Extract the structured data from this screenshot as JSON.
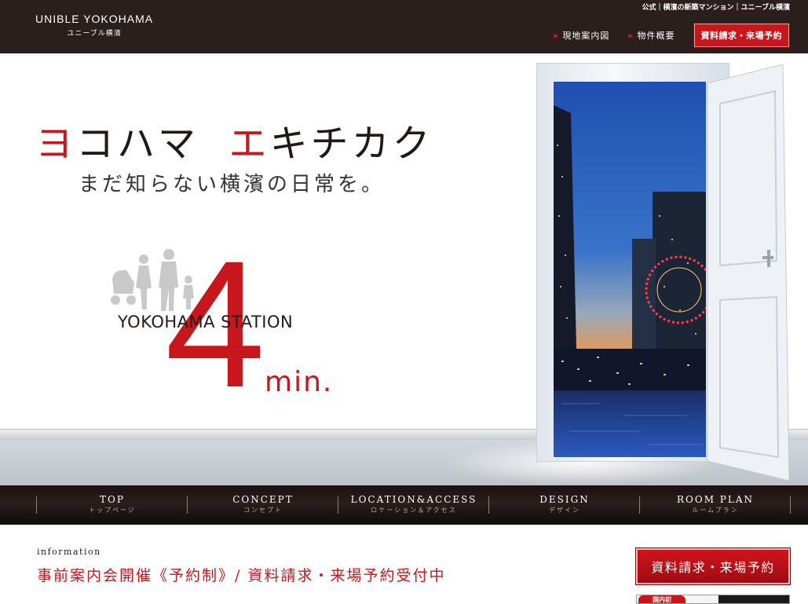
{
  "header": {
    "logo_en": "UNIBLE YOKOHAMA",
    "logo_ja": "ユニーブル横濱",
    "tagline": "公式｜横濱の新築マンション｜ユニーブル横濱",
    "links": [
      {
        "label": "現地案内図"
      },
      {
        "label": "物件概要"
      }
    ],
    "cta_label": "資料請求・来場予約"
  },
  "hero": {
    "headline_red1": "ヨ",
    "headline_1": "コハマ",
    "headline_red2": "エ",
    "headline_2": "キチカク",
    "subline": "まだ知らない横濱の日常を。",
    "station": "YOKOHAMA STATION",
    "minutes": "4",
    "unit": "min."
  },
  "nav": {
    "items": [
      {
        "en": "TOP",
        "ja": "トップページ"
      },
      {
        "en": "CONCEPT",
        "ja": "コンセプト"
      },
      {
        "en": "LOCATION&ACCESS",
        "ja": "ロケーション＆アクセス"
      },
      {
        "en": "DESIGN",
        "ja": "デザイン"
      },
      {
        "en": "ROOM PLAN",
        "ja": "ルームプラン"
      }
    ]
  },
  "info": {
    "label": "information",
    "title": "事前案内会開催《予約制》/ 資料請求・来場予約受付中",
    "cta_label": "資料請求・来場予約",
    "banner_badge": "国内初"
  },
  "colors": {
    "header_bg": "#2a1f1c",
    "accent_red": "#c8161d",
    "text_dark": "#231815"
  }
}
